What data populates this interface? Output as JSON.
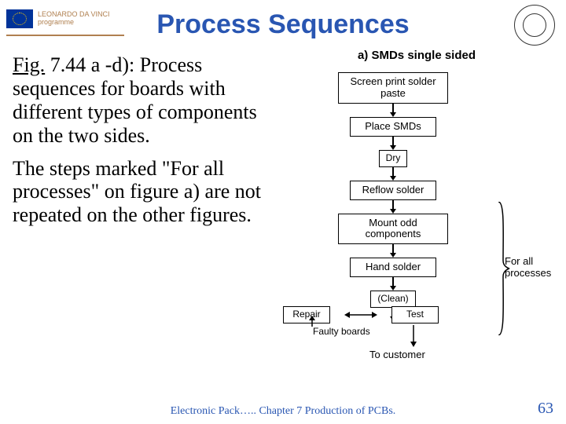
{
  "header": {
    "logo_line1": "LEONARDO DA VINCI",
    "logo_line2": "programme",
    "title": "Process Sequences"
  },
  "body": {
    "fig_label": "Fig.",
    "fig_ref": " 7.44 a -d): ",
    "para1_rest": "Process sequences for boards with different types of components on the two sides.",
    "para2": "The steps marked \"For all processes\" on figure a) are not repeated on the other figures."
  },
  "chart_data": {
    "type": "flowchart",
    "title": "a) SMDs single sided",
    "main_sequence": [
      "Screen print solder paste",
      "Place SMDs",
      "Dry",
      "Reflow solder",
      "Mount odd components",
      "Hand solder",
      "(Clean)"
    ],
    "bottom_row": {
      "left": "Repair",
      "right": "Test"
    },
    "faulty_label": "Faulty boards",
    "terminal": "To customer",
    "brace_group": {
      "covers": [
        "Mount odd components",
        "Hand solder",
        "(Clean)",
        "Repair/Test row"
      ],
      "label": "For all processes"
    }
  },
  "footer": {
    "text": "Electronic Pack…..   Chapter 7 Production of PCBs.",
    "page": "63"
  }
}
